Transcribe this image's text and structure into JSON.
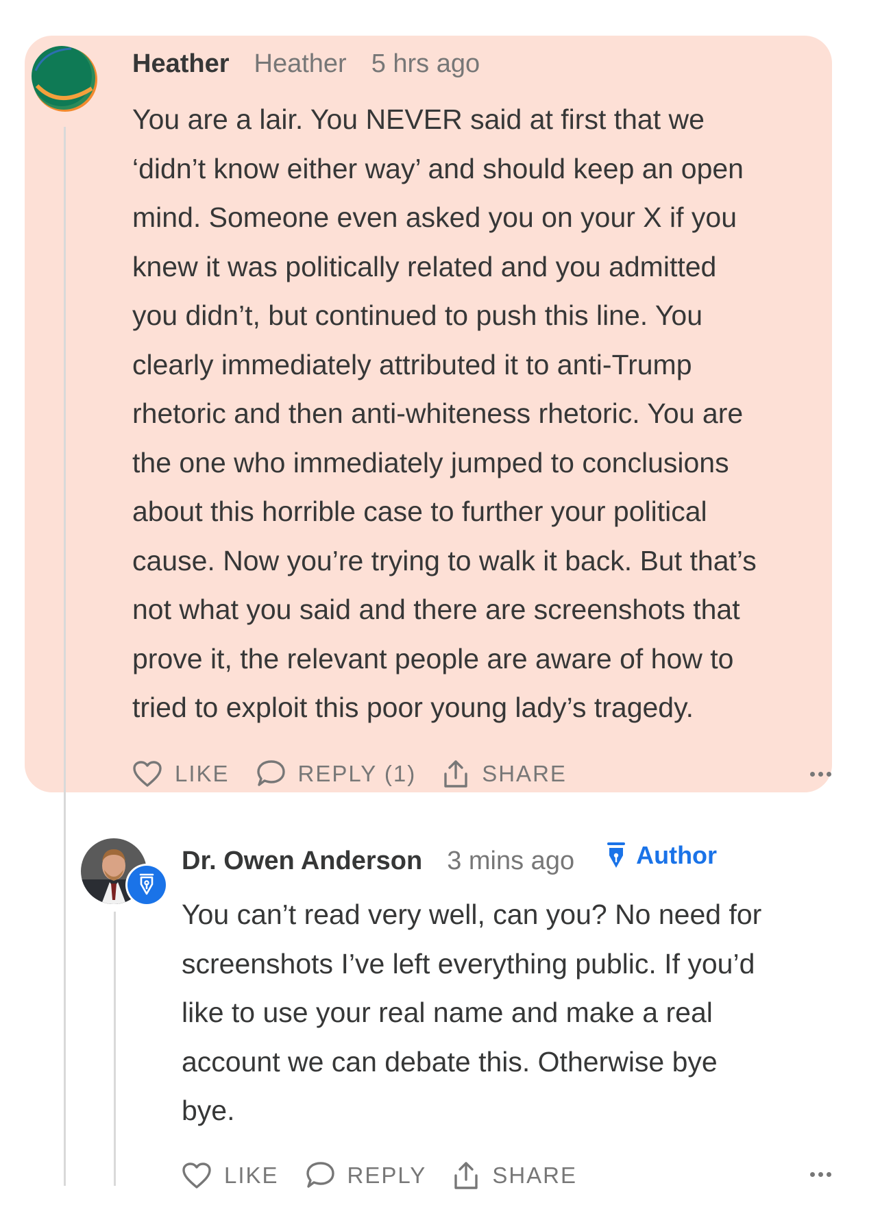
{
  "comment": {
    "author": "Heather",
    "handle": "Heather",
    "timestamp": "5 hrs ago",
    "body": "You are a lair. You NEVER said at first that we\n‘didn’t know either way’ and should keep an open\nmind. Someone even asked you on your X if you\nknew it was politically related and you admitted\nyou didn’t, but continued to push this line. You\nclearly immediately attributed it to anti-Trump\nrhetoric and then anti-whiteness rhetoric. You are\nthe one who immediately jumped to conclusions\nabout this horrible case to further your political\ncause. Now you’re trying to walk it back. But that’s\nnot what you said and there are screenshots that\nprove it, the relevant people are aware of how to\ntried to exploit this poor young lady’s tragedy.",
    "actions": {
      "like": "LIKE",
      "reply": "REPLY (1)",
      "share": "SHARE"
    }
  },
  "reply": {
    "author": "Dr. Owen Anderson",
    "timestamp": "3 mins ago",
    "badge": "Author",
    "body": "You can’t read very well, can you? No need for\nscreenshots I’ve left everything public. If you’d\nlike to use your real name and make a real\naccount we can debate this. Otherwise bye\nbye.",
    "actions": {
      "like": "LIKE",
      "reply": "REPLY",
      "share": "SHARE"
    }
  },
  "colors": {
    "highlight": "#fde0d6",
    "accent": "#1a73e8",
    "text": "#363737",
    "muted": "#777777"
  },
  "icons": [
    "heart-icon",
    "comment-bubble-icon",
    "share-upload-icon",
    "more-dots-icon",
    "fountain-pen-icon"
  ]
}
